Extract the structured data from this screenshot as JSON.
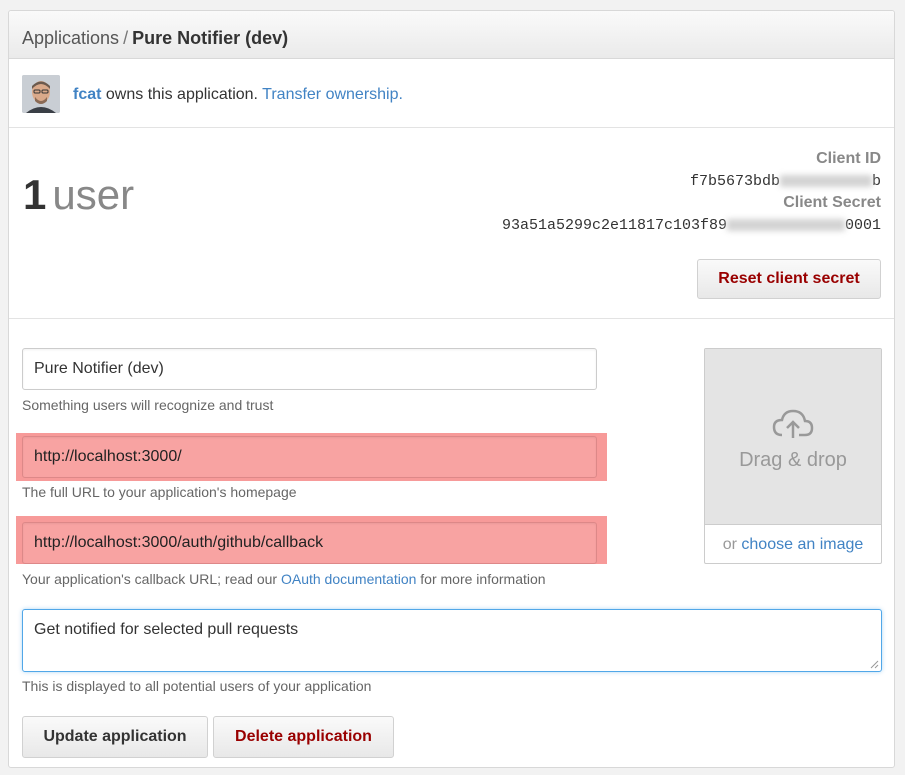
{
  "breadcrumb": {
    "parent": "Applications",
    "separator": "/",
    "current": "Pure Notifier (dev)"
  },
  "owner": {
    "username": "fcat",
    "owns_text": "owns this application.",
    "transfer_link": "Transfer ownership."
  },
  "stats": {
    "user_count": "1",
    "user_label": "user"
  },
  "credentials": {
    "client_id_label": "Client ID",
    "client_id_visible": "f7b5673bdb",
    "client_id_tail": "b",
    "client_secret_label": "Client Secret",
    "client_secret_visible": "93a51a5299c2e11817c103f89",
    "client_secret_tail": "0001",
    "reset_button": "Reset client secret"
  },
  "form": {
    "name_value": "Pure Notifier (dev)",
    "name_hint": "Something users will recognize and trust",
    "homepage_value": "http://localhost:3000/",
    "homepage_hint": "The full URL to your application's homepage",
    "callback_value": "http://localhost:3000/auth/github/callback",
    "callback_hint_pre": "Your application's callback URL; read our ",
    "callback_hint_link": "OAuth documentation",
    "callback_hint_post": " for more information",
    "description_value": "Get notified for selected pull requests",
    "description_hint": "This is displayed to all potential users of your application",
    "update_button": "Update application",
    "delete_button": "Delete application"
  },
  "logo_upload": {
    "drag_text": "Drag & drop",
    "or_text": "or ",
    "choose_link": "choose an image"
  },
  "colors": {
    "link": "#4183c4",
    "danger": "#990000",
    "highlight": "#f79a99",
    "focus_border": "#51a7e8"
  }
}
